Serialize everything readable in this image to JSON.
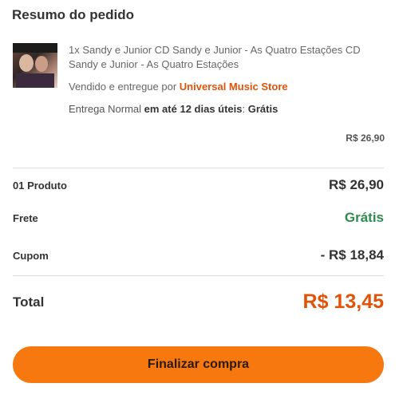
{
  "summary": {
    "title": "Resumo do pedido"
  },
  "item": {
    "thumbnail_icon": "album-cover-image",
    "description": "1x Sandy e Junior CD Sandy e Junior - As Quatro Estações CD Sandy e Junior - As Quatro Estações",
    "seller_prefix": "Vendido e entregue por ",
    "seller_name": "Universal Music Store",
    "delivery_prefix": "Entrega Normal ",
    "delivery_time": "em até 12 dias úteis",
    "delivery_sep": ": ",
    "delivery_cost": "Grátis",
    "price": "R$ 26,90"
  },
  "totals": {
    "products_label": "01 Produto",
    "products_value": "R$ 26,90",
    "shipping_label": "Frete",
    "shipping_value": "Grátis",
    "coupon_label": "Cupom",
    "coupon_value": "- R$ 18,84",
    "total_label": "Total",
    "total_value": "R$ 13,45"
  },
  "actions": {
    "checkout_label": "Finalizar compra"
  },
  "colors": {
    "accent": "#f7780f",
    "seller": "#e2530a",
    "free": "#2e8b4e",
    "total": "#e2530a"
  }
}
